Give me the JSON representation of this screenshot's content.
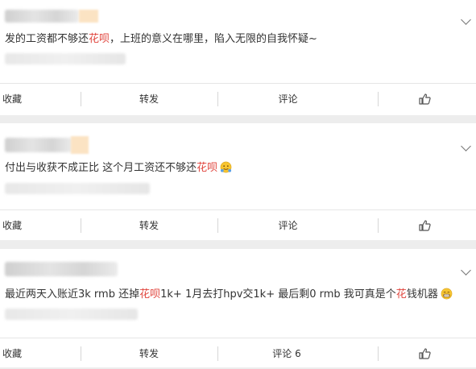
{
  "comments": [
    {
      "text_parts": [
        {
          "t": "发的工资都不够还",
          "hl": false
        },
        {
          "t": "花呗",
          "hl": true
        },
        {
          "t": "，上班的意义在哪里，陷入无限的自我怀疑~",
          "hl": false
        }
      ],
      "actions": {
        "collect": "收藏",
        "forward": "转发",
        "comment": "评论"
      }
    },
    {
      "text_parts": [
        {
          "t": "付出与收获不成正比 这个月工资还不够还",
          "hl": false
        },
        {
          "t": "花呗",
          "hl": true
        }
      ],
      "actions": {
        "collect": "收藏",
        "forward": "转发",
        "comment": "评论"
      }
    },
    {
      "text_parts": [
        {
          "t": "最近两天入账近3k rmb 还掉",
          "hl": false
        },
        {
          "t": "花呗",
          "hl": true
        },
        {
          "t": "1k+ 1月去打hpv交1k+ 最后剩0 rmb 我可真是个",
          "hl": false
        },
        {
          "t": "花",
          "hl": true
        },
        {
          "t": "钱机器",
          "hl": false
        }
      ],
      "actions": {
        "collect": "收藏",
        "forward": "转发",
        "comment": "评论 6"
      }
    }
  ],
  "colors": {
    "highlight": "#e0433b",
    "background": "#ededed"
  },
  "icons": {
    "expand": "chevron-down-icon",
    "like": "thumbs-up-icon",
    "emoji2": "hug-emoji-icon",
    "emoji3": "grin-emoji-icon"
  }
}
